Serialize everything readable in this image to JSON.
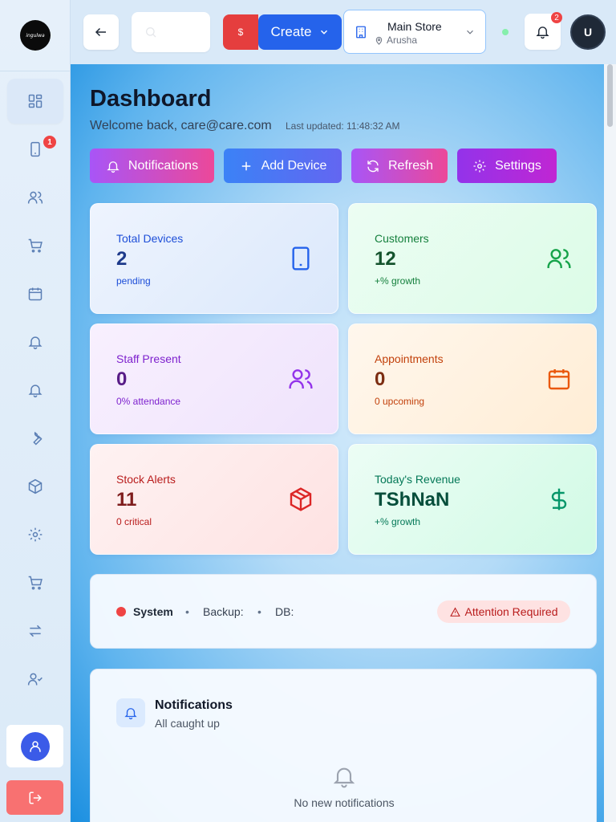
{
  "sidebar": {
    "logo_text": "ingulwa",
    "badge_count": "1"
  },
  "topbar": {
    "dollar_label": "$",
    "create_label": "Create",
    "store_name": "Main Store",
    "store_location": "Arusha",
    "notification_count": "2",
    "avatar_initial": "U"
  },
  "dashboard": {
    "title": "Dashboard",
    "welcome": "Welcome back, care@care.com",
    "last_updated": "Last updated: 11:48:32 AM"
  },
  "actions": {
    "notifications": "Notifications",
    "add_device": "Add Device",
    "refresh": "Refresh",
    "settings": "Settings"
  },
  "stats": {
    "devices": {
      "label": "Total Devices",
      "value": "2",
      "sub": "pending",
      "color": "#1d4ed8"
    },
    "customers": {
      "label": "Customers",
      "value": "12",
      "sub": "+% growth",
      "color": "#15803d"
    },
    "staff": {
      "label": "Staff Present",
      "value": "0",
      "sub": "0% attendance",
      "color": "#7e22ce"
    },
    "appointments": {
      "label": "Appointments",
      "value": "0",
      "sub": "0 upcoming",
      "color": "#c2410c"
    },
    "stock": {
      "label": "Stock Alerts",
      "value": "11",
      "sub": "0 critical",
      "color": "#b91c1c"
    },
    "revenue": {
      "label": "Today's Revenue",
      "value": "TShNaN",
      "sub": "+% growth",
      "color": "#047857"
    }
  },
  "system": {
    "label": "System",
    "sep": "•",
    "backup": "Backup:",
    "db": "DB:",
    "status": "Attention Required"
  },
  "notifications_panel": {
    "title": "Notifications",
    "subtitle": "All caught up",
    "empty": "No new notifications"
  }
}
